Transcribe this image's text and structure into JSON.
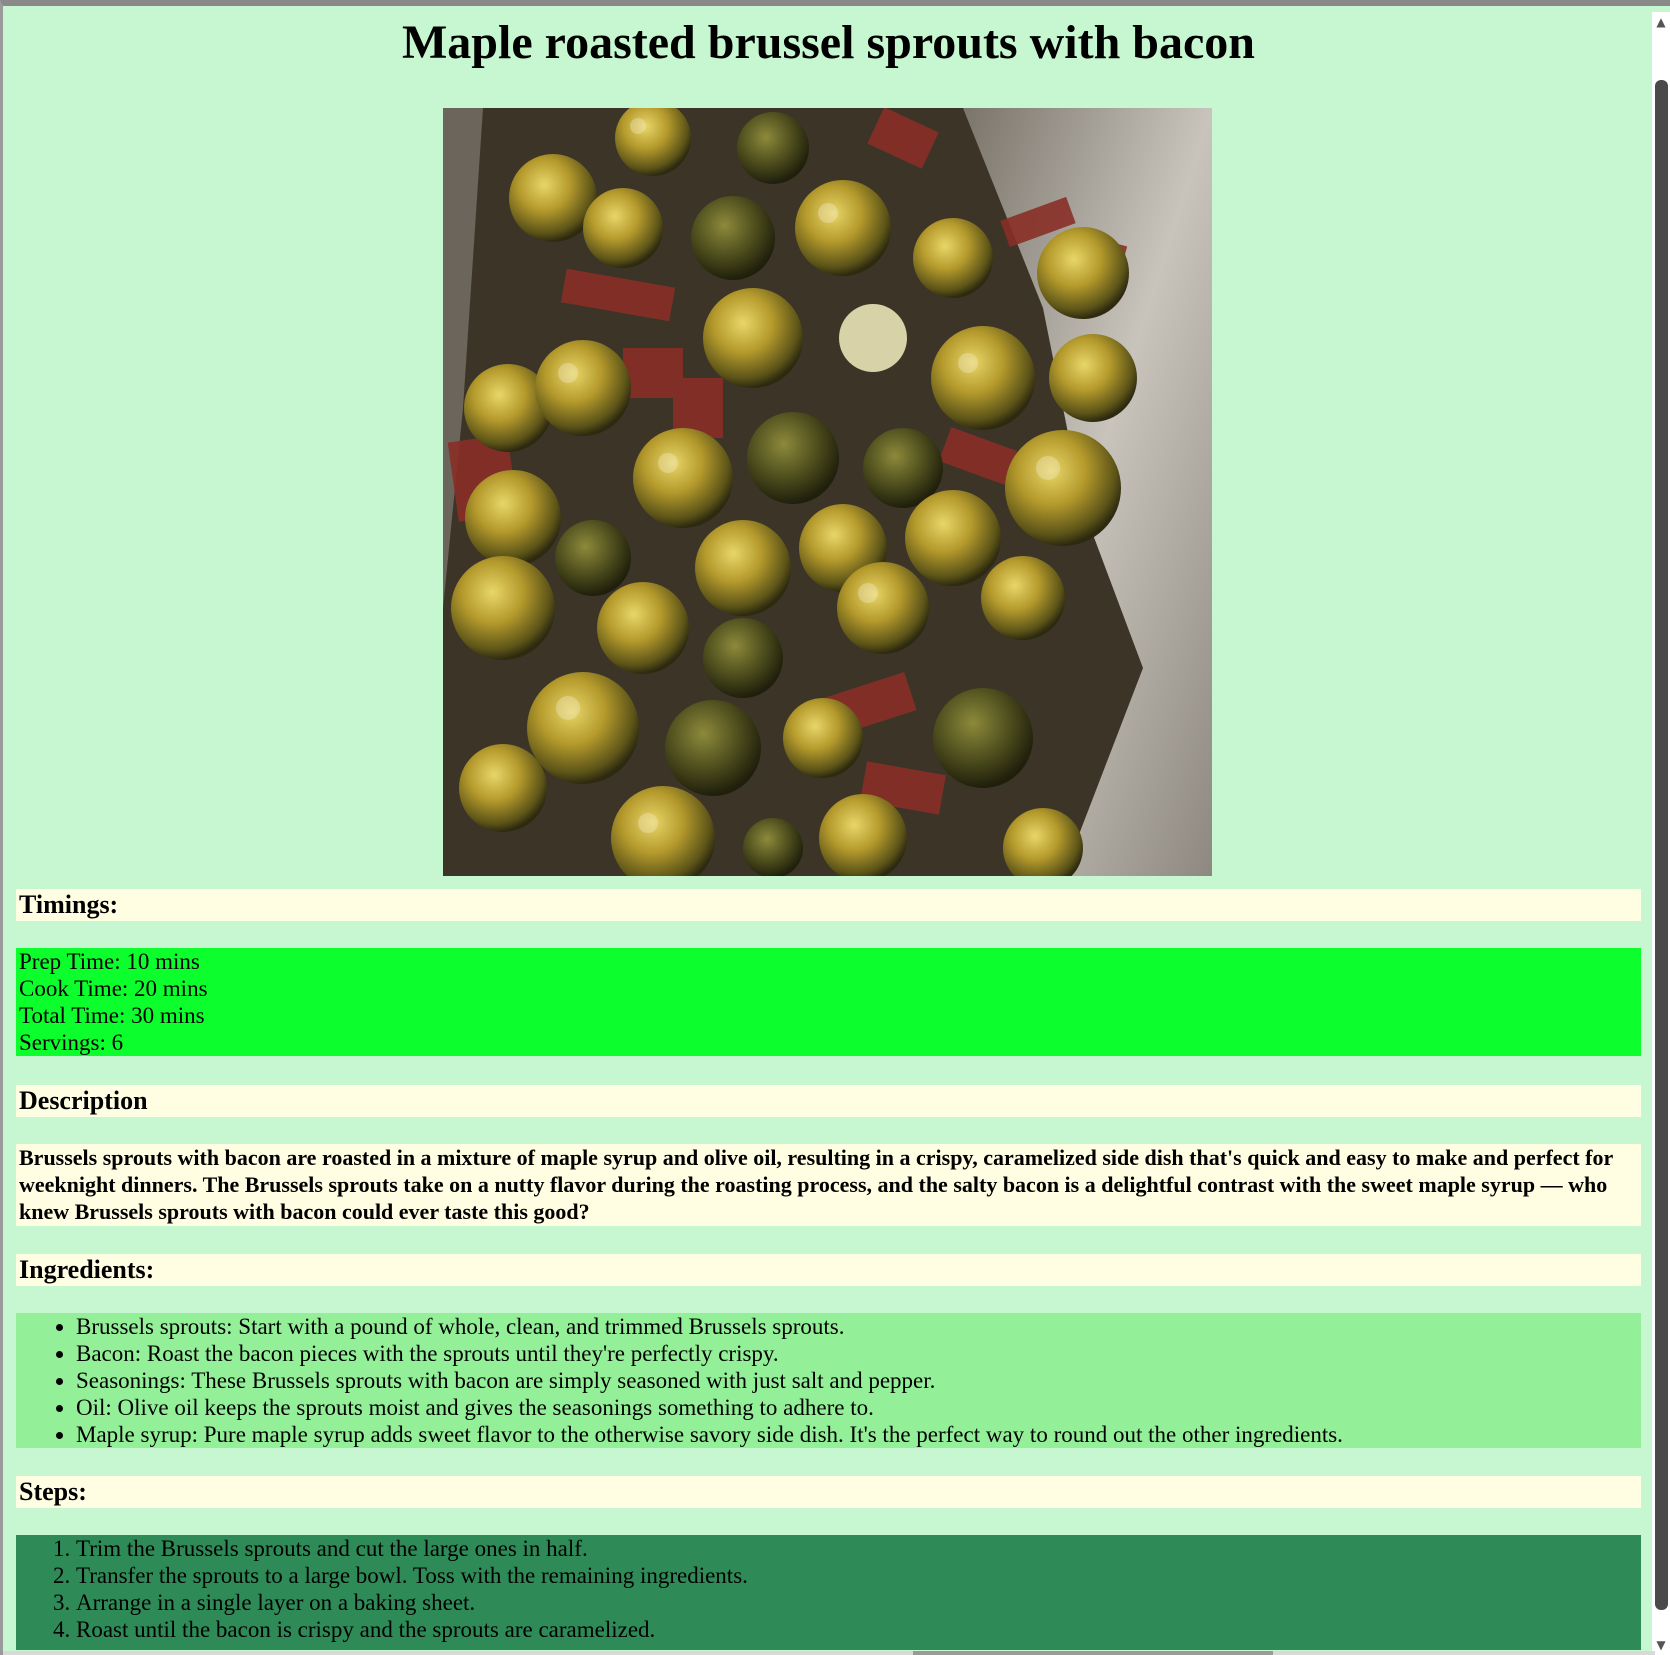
{
  "page": {
    "title": "Maple roasted brussel sprouts with bacon"
  },
  "hero_image": {
    "alt": "Maple roasted brussel sprouts with bacon"
  },
  "timings": {
    "heading": "Timings:",
    "prep": "Prep Time: 10 mins",
    "cook": "Cook Time: 20 mins",
    "total": "Total Time: 30 mins",
    "servings": "Servings: 6"
  },
  "description": {
    "heading": "Description",
    "text": "Brussels sprouts with bacon are roasted in a mixture of maple syrup and olive oil, resulting in a crispy, caramelized side dish that's quick and easy to make and perfect for weeknight dinners. The Brussels sprouts take on a nutty flavor during the roasting process, and the salty bacon is a delightful contrast with the sweet maple syrup — who knew Brussels sprouts with bacon could ever taste this good?"
  },
  "ingredients": {
    "heading": "Ingredients:",
    "items": [
      "Brussels sprouts: Start with a pound of whole, clean, and trimmed Brussels sprouts.",
      "Bacon: Roast the bacon pieces with the sprouts until they're perfectly crispy.",
      "Seasonings: These Brussels sprouts with bacon are simply seasoned with just salt and pepper.",
      "Oil: Olive oil keeps the sprouts moist and gives the seasonings something to adhere to.",
      "Maple syrup: Pure maple syrup adds sweet flavor to the otherwise savory side dish. It's the perfect way to round out the other ingredients."
    ]
  },
  "steps": {
    "heading": "Steps:",
    "items": [
      "Trim the Brussels sprouts and cut the large ones in half.",
      "Transfer the sprouts to a large bowl. Toss with the remaining ingredients.",
      "Arrange in a single layer on a baking sheet.",
      "Roast until the bacon is crispy and the sprouts are caramelized."
    ]
  },
  "colors": {
    "page_bg": "#c7f7d0",
    "heading_bg": "#fffee2",
    "timings_bg": "#0cff2c",
    "ingredients_bg": "#93ef98",
    "steps_bg": "#2e8b57"
  },
  "icons": {
    "scroll_up": "triangle-up-icon",
    "scroll_down": "triangle-down-icon"
  }
}
